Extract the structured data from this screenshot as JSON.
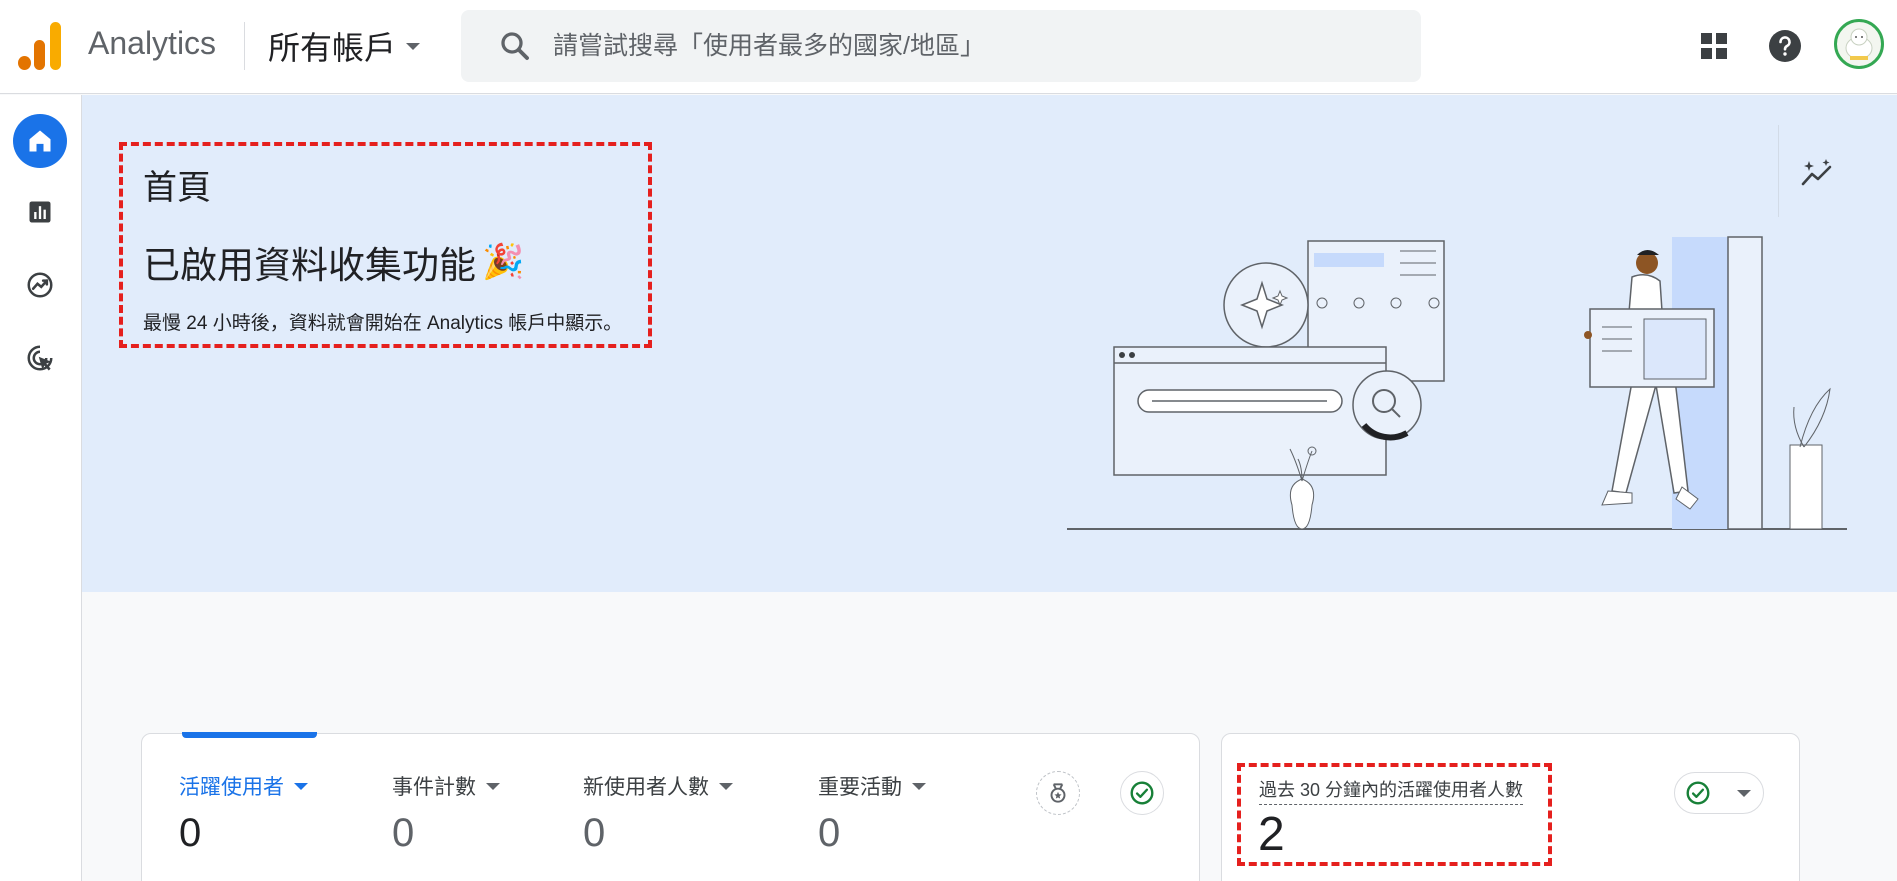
{
  "header": {
    "app_name": "Analytics",
    "account_name": "所有帳戶",
    "search_placeholder": "請嘗試搜尋「使用者最多的國家/地區」",
    "logo_colors": [
      "#f9ab00",
      "#e37400",
      "#e37400"
    ],
    "icons": [
      "search-icon",
      "apps-grid-icon",
      "help-icon",
      "avatar"
    ]
  },
  "sidebar": {
    "items": [
      {
        "name": "home",
        "icon": "home-icon",
        "active": true
      },
      {
        "name": "reports",
        "icon": "bar-chart-icon",
        "active": false
      },
      {
        "name": "explore",
        "icon": "explore-trend-icon",
        "active": false
      },
      {
        "name": "advertising",
        "icon": "target-cursor-icon",
        "active": false
      }
    ]
  },
  "hero": {
    "title": "首頁",
    "heading": "已啟用資料收集功能",
    "emoji": "🎉",
    "subtitle": "最慢 24 小時後，資料就會開始在 Analytics 帳戶中顯示。",
    "background": "#e1ecfb"
  },
  "metrics": [
    {
      "label": "活躍使用者",
      "value": "0",
      "active": true
    },
    {
      "label": "事件計數",
      "value": "0",
      "active": false
    },
    {
      "label": "新使用者人數",
      "value": "0",
      "active": false
    },
    {
      "label": "重要活動",
      "value": "0",
      "active": false
    }
  ],
  "realtime": {
    "label": "過去 30 分鐘內的活躍使用者人數",
    "value": "2"
  },
  "colors": {
    "accent": "#1a73e8",
    "annotation": "#e5201e",
    "success": "#188038"
  }
}
